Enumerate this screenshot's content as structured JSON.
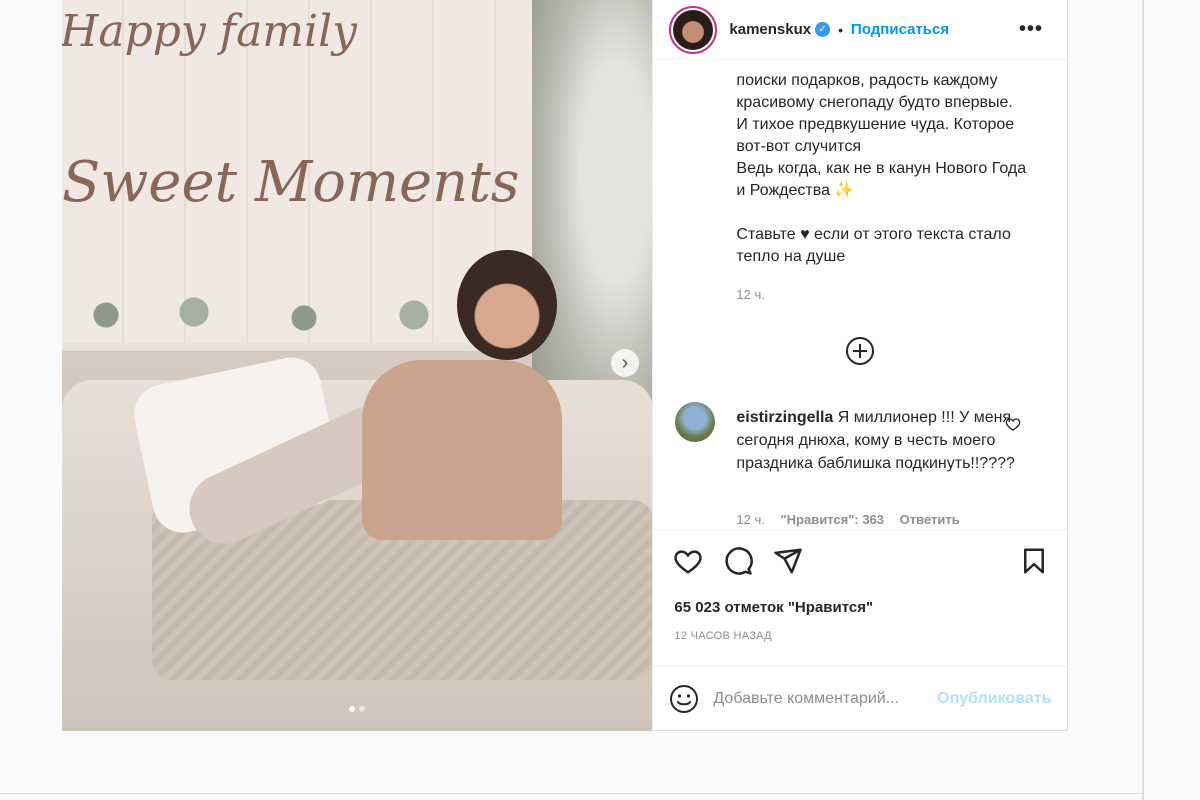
{
  "post": {
    "photo": {
      "wall_text_1": "Happy family",
      "wall_text_2": "Sweet Moments",
      "next_label": "›",
      "carousel_count": 2,
      "carousel_active": 1
    },
    "header": {
      "username": "kamenskux",
      "verified_mark": "✓",
      "separator": "•",
      "follow_label": "Подписаться",
      "more_label": "•••"
    },
    "caption": {
      "text": "поиски подарков, радость каждому\nкрасивому снегопаду будто впервые.\nИ тихое предвкушение чуда. Которое\nвот-вот случится\nВедь когда, как не в канун Нового Года\nи Рождества ✨\n\nСтавьте ♥ если от этого текста стало\nтепло на душе",
      "time": "12 ч."
    },
    "comment": {
      "user": "eistirzingella",
      "text": "Я миллионер !!! У меня сегодня днюха, кому в честь моего праздника баблишка подкинуть!!????",
      "time": "12 ч.",
      "likes": "\"Нравится\": 363",
      "reply": "Ответить"
    },
    "likes_text": "65 023 отметок \"Нравится\"",
    "date_text": "12 ЧАСОВ НАЗАД",
    "add_comment": {
      "placeholder": "Добавьте комментарий...",
      "publish_label": "Опубликовать"
    }
  },
  "colors": {
    "accent": "#0095f6",
    "publish_disabled": "#b2dffc",
    "muted": "#8e8e8e",
    "text": "#262626"
  }
}
